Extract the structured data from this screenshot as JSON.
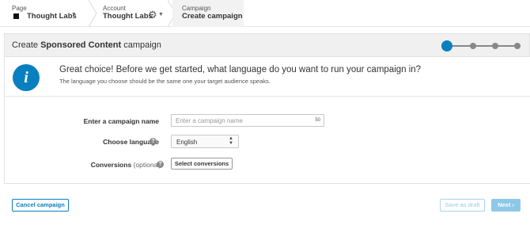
{
  "breadcrumb": {
    "page": {
      "label": "Page",
      "value": "Thought Labs"
    },
    "account": {
      "label": "Account",
      "value": "Thought Labs"
    },
    "campaign": {
      "label": "Campaign",
      "value": "Create campaign"
    }
  },
  "header": {
    "title_prefix": "Create ",
    "title_bold": "Sponsored Content",
    "title_suffix": " campaign",
    "steps_total": 4,
    "current_step": 1
  },
  "info": {
    "icon": "info-icon",
    "headline": "Great choice! Before we get started, what language do you want to run your campaign in?",
    "subtext": "The language you choose should be the same one your target audience speaks."
  },
  "form": {
    "campaign_name": {
      "label": "Enter a campaign name",
      "placeholder": "Enter a campaign name",
      "char_limit": "50"
    },
    "language": {
      "label": "Choose language",
      "selected": "English"
    },
    "conversions": {
      "label": "Conversions",
      "optional": "(optional)",
      "button": "Select conversions"
    }
  },
  "footer": {
    "cancel_label": "Cancel campaign",
    "draft_label": "Save as draft",
    "next_label": "Next ›"
  },
  "colors": {
    "accent": "#0a7fbf",
    "step_inactive": "#888888",
    "title_bar_bg": "#f0f0f0"
  }
}
